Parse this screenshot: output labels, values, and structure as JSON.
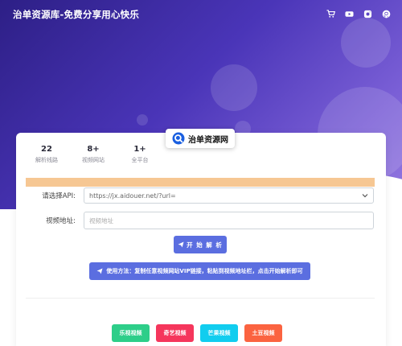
{
  "header": {
    "brand": "治单资源库-免费分享用心快乐",
    "icons": [
      "cart-icon",
      "youtube-icon",
      "instagram-icon",
      "github-icon"
    ]
  },
  "logo": {
    "text": "治单资源网",
    "icon": "search-icon",
    "accent": "#1a5fe0"
  },
  "stats": [
    {
      "value": "22",
      "label": "解析线路"
    },
    {
      "value": "8+",
      "label": "视频网站"
    },
    {
      "value": "1+",
      "label": "全平台"
    }
  ],
  "form": {
    "api_label": "请选择API:",
    "api_selected": "https://jx.aidouer.net/?url=",
    "url_label": "视频地址:",
    "url_placeholder": "视频地址"
  },
  "buttons": {
    "start": "开 始 解 析",
    "hint": "使用方法：复制任意视频网站VIP链接，粘贴到视频地址栏，点击开始解析即可"
  },
  "sites": [
    {
      "label": "乐视视频",
      "color": "#2dce89"
    },
    {
      "label": "奇艺视频",
      "color": "#f5365c"
    },
    {
      "label": "芒果视频",
      "color": "#11cdef"
    },
    {
      "label": "土豆视频",
      "color": "#fb6340"
    }
  ],
  "colors": {
    "hero_start": "#2d1f86",
    "hero_end": "#9479e0",
    "primary": "#5b6ee0",
    "notice": "#f6c793"
  }
}
